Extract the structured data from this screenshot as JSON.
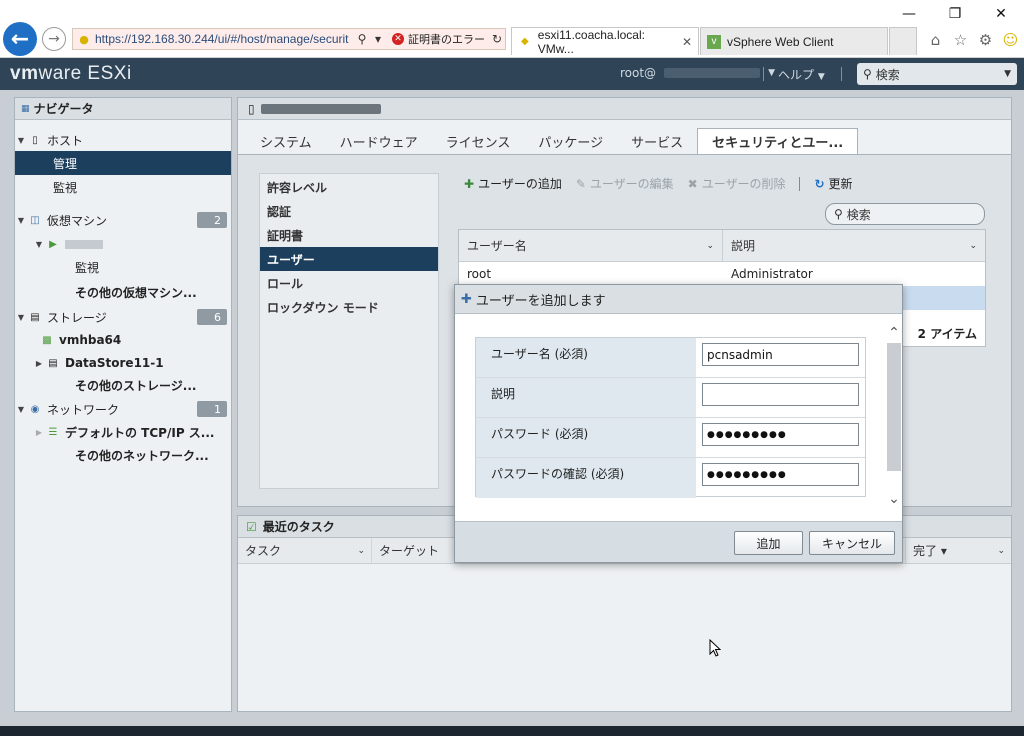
{
  "browser": {
    "url": "https://192.168.30.244/ui/#/host/manage/securit",
    "cert_error": "証明書のエラー",
    "tabs": [
      {
        "label": "esxi11.coacha.local: VMw..."
      },
      {
        "label": "vSphere Web Client"
      }
    ]
  },
  "header": {
    "logo_vm": "vm",
    "logo_ware": "ware",
    "logo_product": " ESXi",
    "user": "root@",
    "help": "ヘルプ",
    "search_placeholder": "検索"
  },
  "navigator": {
    "title": "ナビゲータ",
    "items": [
      {
        "label": "ホスト"
      },
      {
        "label": "管理"
      },
      {
        "label": "監視"
      },
      {
        "label": "仮想マシン",
        "badge": "2"
      },
      {
        "label": ""
      },
      {
        "label": "監視"
      },
      {
        "label": "その他の仮想マシン..."
      },
      {
        "label": "ストレージ",
        "badge": "6"
      },
      {
        "label": "vmhba64"
      },
      {
        "label": "DataStore11-1"
      },
      {
        "label": "その他のストレージ..."
      },
      {
        "label": "ネットワーク",
        "badge": "1"
      },
      {
        "label": "デフォルトの TCP/IP ス..."
      },
      {
        "label": "その他のネットワーク..."
      }
    ]
  },
  "host": {
    "tabs": [
      "システム",
      "ハードウェア",
      "ライセンス",
      "パッケージ",
      "サービス",
      "セキュリティとユー..."
    ],
    "security_menu": [
      "許容レベル",
      "認証",
      "証明書",
      "ユーザー",
      "ロール",
      "ロックダウン モード"
    ],
    "toolbar": {
      "add_user": "ユーザーの追加",
      "edit_user": "ユーザーの編集",
      "delete_user": "ユーザーの削除",
      "refresh": "更新"
    },
    "search_placeholder": "検索",
    "table": {
      "columns": [
        "ユーザー名",
        "説明"
      ],
      "rows": [
        [
          "root",
          "Administrator"
        ],
        [
          "",
          ""
        ]
      ],
      "count": "2 アイテム"
    }
  },
  "tasks": {
    "title": "最近のタスク",
    "columns": [
      "タスク",
      "ターゲット",
      "完了 ▾"
    ]
  },
  "dialog": {
    "title": "ユーザーを追加します",
    "fields": [
      {
        "label": "ユーザー名 (必須)",
        "value": "pcnsadmin"
      },
      {
        "label": "説明",
        "value": ""
      },
      {
        "label": "パスワード (必須)",
        "value": "●●●●●●●●●"
      },
      {
        "label": "パスワードの確認 (必須)",
        "value": "●●●●●●●●●"
      }
    ],
    "add_button": "追加",
    "cancel_button": "キャンセル"
  }
}
